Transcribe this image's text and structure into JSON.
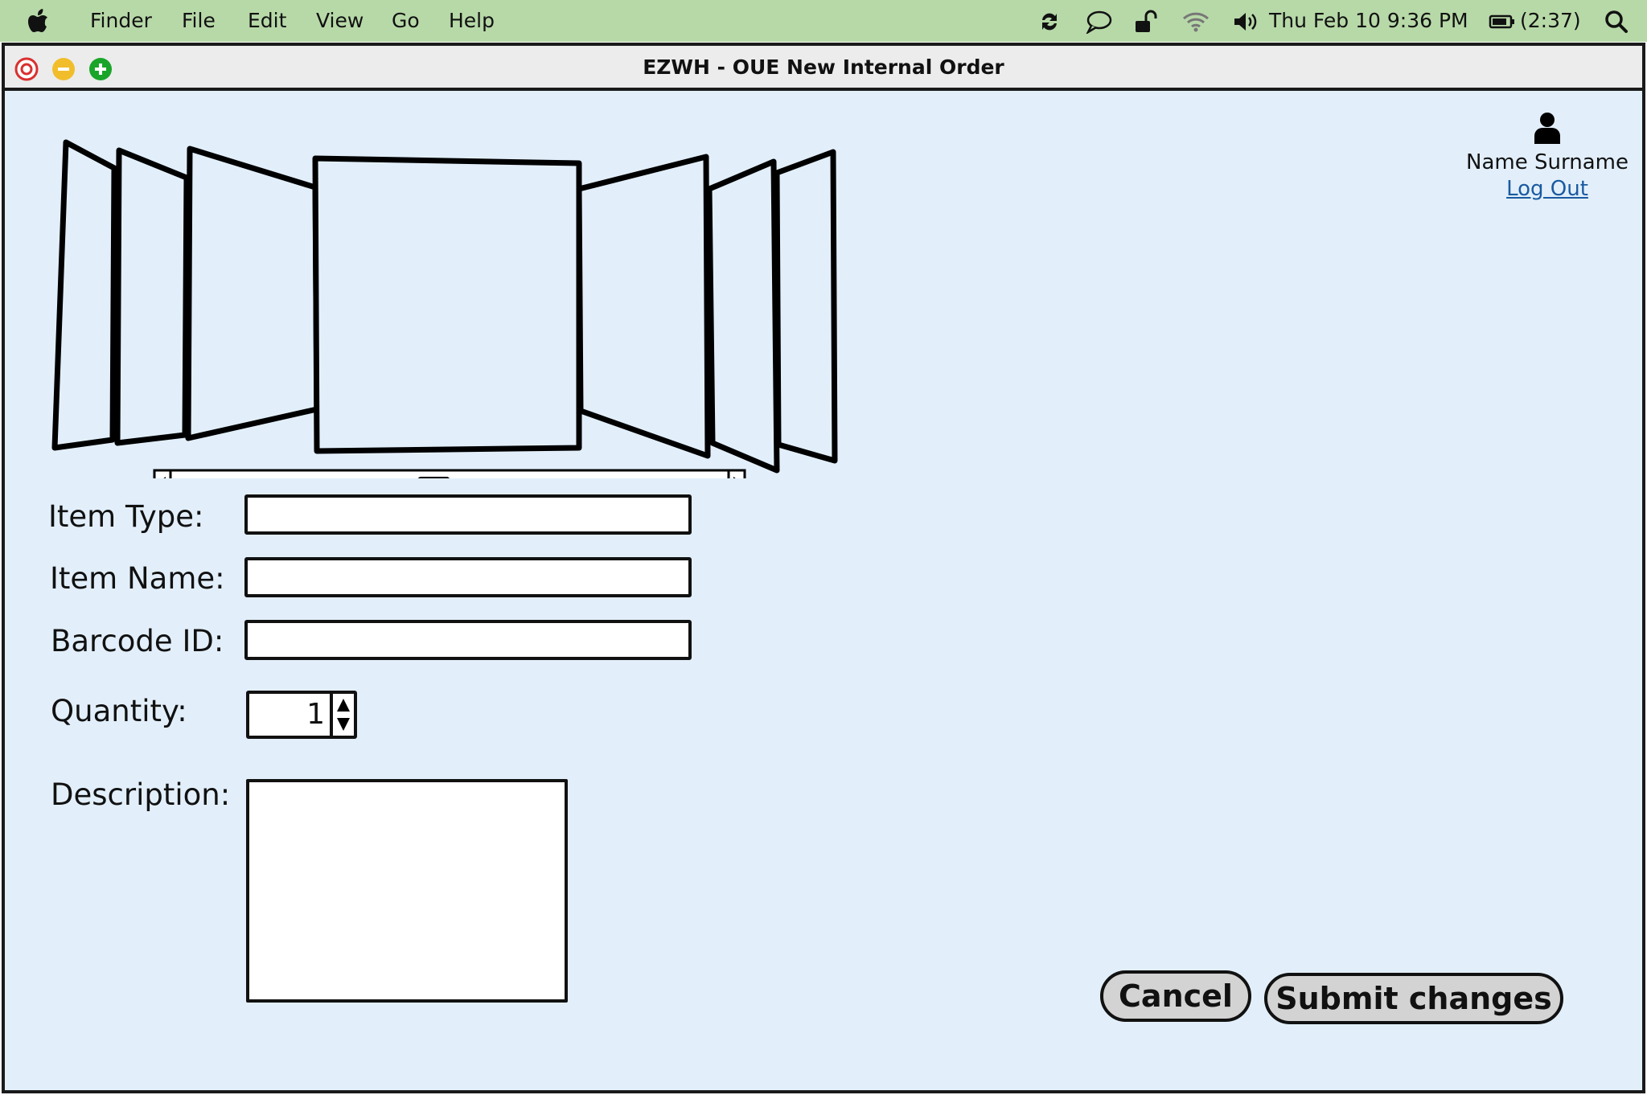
{
  "menubar": {
    "apple_icon": "apple-icon",
    "items": [
      {
        "label": "Finder"
      },
      {
        "label": "File"
      },
      {
        "label": "Edit"
      },
      {
        "label": "View"
      },
      {
        "label": "Go"
      },
      {
        "label": "Help"
      }
    ],
    "status_icons": [
      "sync-icon",
      "chat-bubble-icon",
      "unlock-icon",
      "wifi-icon",
      "volume-icon",
      "battery-icon",
      "search-icon"
    ],
    "datetime": "Thu Feb 10  9:36 PM",
    "battery_text": "(2:37)"
  },
  "window": {
    "title": "EZWH - OUE New Internal Order",
    "controls": [
      "close-button",
      "minimize-button",
      "zoom-button"
    ],
    "background": "#e2effb"
  },
  "user": {
    "icon": "user-icon",
    "name": "Name Surname",
    "logout_label": "Log Out"
  },
  "coverflow": {
    "icon": "coverflow-image-carousel",
    "scroll_position": 0.47
  },
  "form": {
    "item_type_label": "Item Type:",
    "item_type_value": "",
    "item_name_label": "Item Name:",
    "item_name_value": "",
    "barcode_label": "Barcode ID:",
    "barcode_value": "",
    "quantity_label": "Quantity:",
    "quantity_value": "1",
    "description_label": "Description:",
    "description_value": ""
  },
  "actions": {
    "cancel_label": "Cancel",
    "submit_label": "Submit changes",
    "button_color": "#d3d3d3"
  }
}
